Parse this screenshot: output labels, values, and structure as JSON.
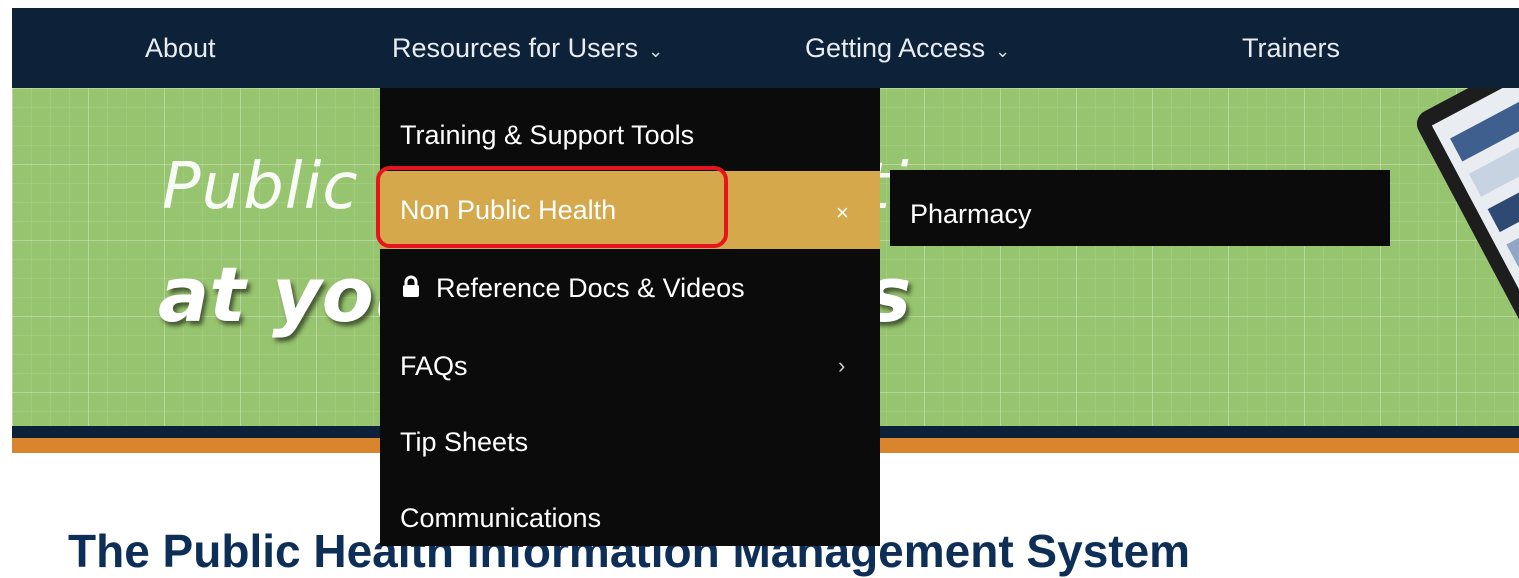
{
  "nav": {
    "items": [
      {
        "label": "About"
      },
      {
        "label": "Resources for Users"
      },
      {
        "label": "Getting Access"
      },
      {
        "label": "Trainers"
      }
    ],
    "chevron": "⌄"
  },
  "hero": {
    "line1": "Public health information",
    "line2": "at your fingertips"
  },
  "dropdown": {
    "items": [
      {
        "label": "Training & Support Tools"
      },
      {
        "label": "Non Public Health",
        "marker": "×",
        "active": true
      },
      {
        "label": "Reference Docs & Videos",
        "icon": "lock-icon"
      },
      {
        "label": "FAQs",
        "marker": "›"
      },
      {
        "label": "Tip Sheets"
      },
      {
        "label": "Communications"
      }
    ]
  },
  "submenu": {
    "items": [
      {
        "label": "Pharmacy"
      }
    ]
  },
  "section": {
    "heading": "The Public Health Information Management System"
  },
  "colors": {
    "nav_bg": "#0d2238",
    "hero_green": "#97c46e",
    "menu_bg": "#0b0b0b",
    "active_item": "#d6a84c",
    "accent_orange": "#d8852e",
    "highlight_red": "#e6151d",
    "heading_blue": "#0d2f57"
  }
}
